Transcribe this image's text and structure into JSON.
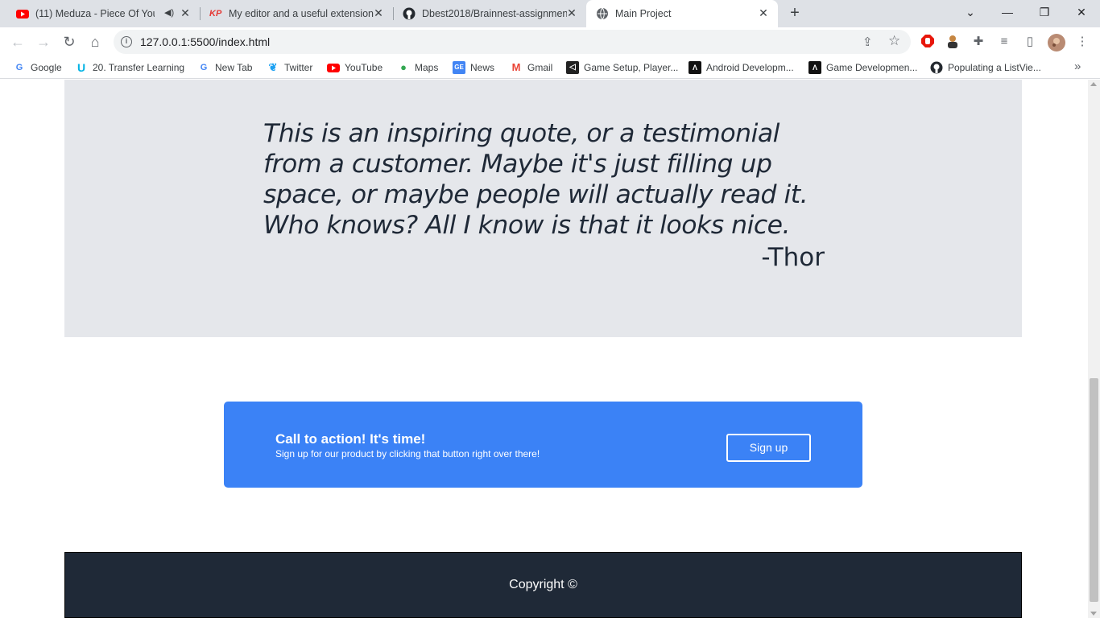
{
  "browser": {
    "tabs": [
      {
        "title": "(11) Meduza - Piece Of Your",
        "favicon": "youtube-icon",
        "muted_icon": "speaker-icon"
      },
      {
        "title": "My editor and a useful extension",
        "favicon": "kp-icon"
      },
      {
        "title": "Dbest2018/Brainnest-assignment",
        "favicon": "github-icon"
      },
      {
        "title": "Main Project",
        "favicon": "globe-icon"
      }
    ],
    "new_tab_label": "+",
    "url": "127.0.0.1:5500/index.html",
    "bookmarks": [
      {
        "label": "Google",
        "icon": "google-icon"
      },
      {
        "label": "20. Transfer Learning",
        "icon": "udacity-icon"
      },
      {
        "label": "New Tab",
        "icon": "google-icon"
      },
      {
        "label": "Twitter",
        "icon": "twitter-icon"
      },
      {
        "label": "YouTube",
        "icon": "youtube-icon"
      },
      {
        "label": "Maps",
        "icon": "maps-icon"
      },
      {
        "label": "News",
        "icon": "news-icon"
      },
      {
        "label": "Gmail",
        "icon": "gmail-icon"
      },
      {
        "label": "Game Setup, Player...",
        "icon": "unity-icon"
      },
      {
        "label": "Android Developm...",
        "icon": "android-dev-icon"
      },
      {
        "label": "Game Developmen...",
        "icon": "android-dev-icon"
      },
      {
        "label": "Populating a ListVie...",
        "icon": "github-icon"
      }
    ]
  },
  "page": {
    "quote": {
      "text": "This is an inspiring quote, or a testimonial from a customer. Maybe it's just filling up space, or maybe people will actually read it. Who knows? All I know is that it looks nice.",
      "author": "-Thor"
    },
    "cta": {
      "title": "Call to action! It's time!",
      "subtitle": "Sign up for our product by clicking that button right over there!",
      "button_label": "Sign up"
    },
    "footer": {
      "copyright": "Copyright ©"
    }
  },
  "colors": {
    "quote_bg": "#e5e7eb",
    "cta_bg": "#3b82f6",
    "footer_bg": "#1f2937"
  }
}
